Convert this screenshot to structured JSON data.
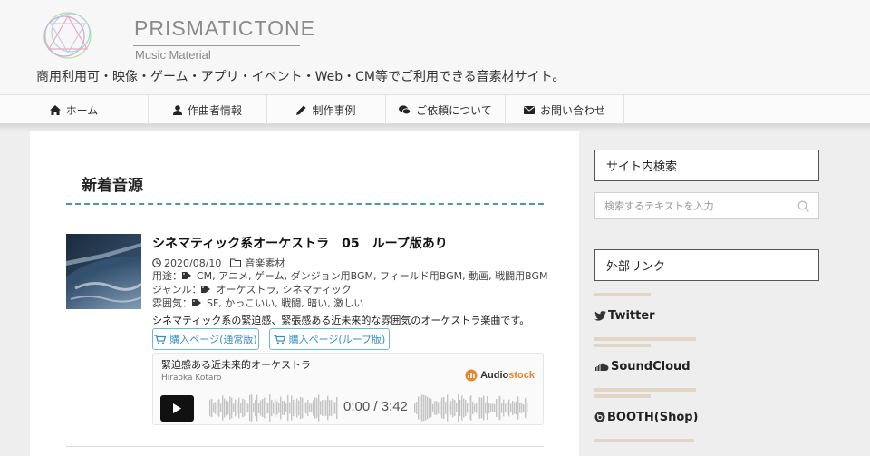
{
  "site": {
    "logo_name": "PRISMATICTONE",
    "logo_sub": "Music Material",
    "tagline": "商用利用可・映像・ゲーム・アプリ・イベント・Web・CM等でご利用できる音素材サイト。"
  },
  "nav": [
    {
      "label": "ホーム",
      "icon": "home-icon"
    },
    {
      "label": "作曲者情報",
      "icon": "user-icon"
    },
    {
      "label": "制作事例",
      "icon": "pencil-icon"
    },
    {
      "label": "ご依頼について",
      "icon": "chat-icon"
    },
    {
      "label": "お問い合わせ",
      "icon": "mail-icon"
    }
  ],
  "main": {
    "section_title": "新着音源",
    "post": {
      "title": "シネマティック系オーケストラ　05　ループ版あり",
      "date": "2020/08/10",
      "category": "音楽素材",
      "usage_label": "用途：",
      "usage_tags": "CM, アニメ, ゲーム, ダンジョン用BGM, フィールド用BGM, 動画, 戦闘用BGM",
      "genre_label": "ジャンル：",
      "genre_tags": "オーケストラ, シネマティック",
      "mood_label": "雰囲気：",
      "mood_tags": "SF, かっこいい, 戦闘, 暗い, 激しい",
      "description": "シネマティック系の緊迫感、緊張感ある近未来的な雰囲気のオーケストラ楽曲です。",
      "buy_normal": "購入ページ(通常版)",
      "buy_loop": "購入ページ(ループ版)"
    },
    "player": {
      "track_title": "緊迫感ある近未来的オーケストラ",
      "artist": "Hiraoka Kotaro",
      "brand_a": "Audio",
      "brand_b": "stock",
      "time": "0:00 / 3:42"
    }
  },
  "sidebar": {
    "search_title": "サイト内検索",
    "search_placeholder": "検索するテキストを入力",
    "links_title": "外部リンク",
    "links": [
      {
        "label": "Twitter",
        "icon": "twitter-icon"
      },
      {
        "label": "SoundCloud",
        "icon": "soundcloud-icon"
      },
      {
        "label": "BOOTH(Shop)",
        "icon": "booth-icon"
      }
    ]
  },
  "colors": {
    "accent_dash": "#4a9aa5",
    "button_border": "#6cb6d6",
    "button_text": "#3a8fbf",
    "link_bar": "#e0d5c7",
    "audiostock_orange": "#e8862e"
  }
}
